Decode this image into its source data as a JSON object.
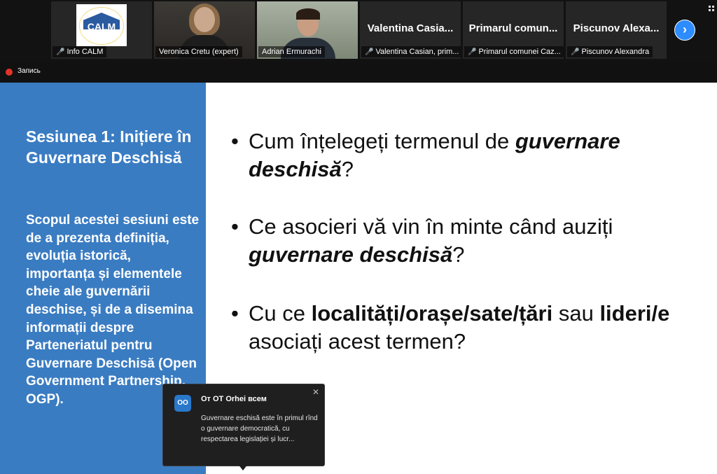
{
  "participants": [
    {
      "display_name": "Info CALM",
      "big_name": "",
      "muted": true
    },
    {
      "display_name": "Veronica Cretu (expert)",
      "big_name": "",
      "muted": false
    },
    {
      "display_name": "Adrian Ermurachi",
      "big_name": "",
      "muted": false
    },
    {
      "display_name": "Valentina Casian, prim...",
      "big_name": "Valentina Casia...",
      "muted": true
    },
    {
      "display_name": "Primarul comunei Caz...",
      "big_name": "Primarul comun...",
      "muted": true
    },
    {
      "display_name": "Piscunov Alexandra",
      "big_name": "Piscunov Alexa...",
      "muted": true
    }
  ],
  "logo_text": "CALM",
  "recording": {
    "label": "Запись"
  },
  "next_page_glyph": "›",
  "slide": {
    "title": "Sesiunea 1: Inițiere în Guvernare Deschisă",
    "description": "Scopul acestei sesiuni este de a prezenta definiția, evoluția istorică, importanța și elementele cheie ale guvernării deschise, și de a disemina informații despre Parteneriatul pentru Guvernare Deschisă (Open Government Partnership, OGP).",
    "bullet_glyph": "•",
    "bullets": [
      {
        "p1": "Cum înțelegeți termenul de ",
        "p2": "guvernare deschisă",
        "p3": "?"
      },
      {
        "p1": "Ce asocieri vă vin în minte când auziți ",
        "p2": "guvernare deschisă",
        "p3": "?"
      },
      {
        "p1": "Cu ce ",
        "p2": "localități/orașe/sate/țări",
        "p3": " sau ",
        "p4": "lideri/e",
        "p5": " asociați acest termen?"
      }
    ]
  },
  "chat": {
    "avatar_initials": "OO",
    "sender": "От OT Orhei всем",
    "message": "Guvernare eschisă este în primul rînd o guvernare democratică, cu respectarea legislației și lucr...",
    "close_glyph": "✕"
  },
  "colors": {
    "slide_panel": "#3a7cc2",
    "active_speaker": "#8cc43c",
    "record": "#e5332a",
    "accent": "#2d8cff"
  }
}
